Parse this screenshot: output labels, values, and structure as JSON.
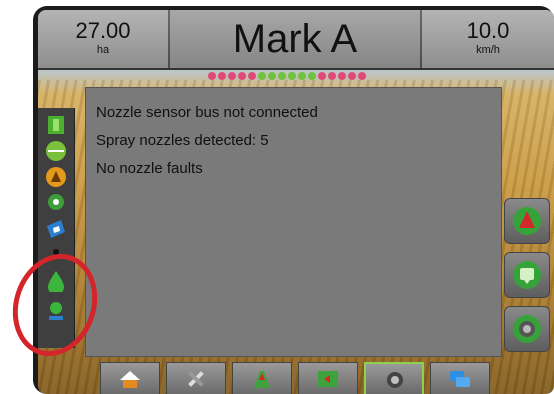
{
  "header": {
    "area_value": "27.00",
    "area_unit": "ha",
    "title": "Mark A",
    "speed_value": "10.0",
    "speed_unit": "km/h"
  },
  "status_leds": [
    "pink",
    "pink",
    "pink",
    "pink",
    "pink",
    "green",
    "green",
    "green",
    "green",
    "green",
    "green",
    "pink",
    "pink",
    "pink",
    "pink",
    "pink"
  ],
  "dialog": {
    "messages": [
      "Nozzle sensor bus not connected",
      "Spray nozzles detected: 5",
      "No nozzle faults"
    ]
  },
  "left_panel": {
    "icons": [
      "boom-section-icon",
      "green-lines-icon",
      "steering-status-icon",
      "gps-status-icon",
      "tilt-sensor-icon",
      "separator-icon",
      "nozzle-drop-icon",
      "nozzle-sensor-icon"
    ]
  },
  "right_buttons": [
    "navigation-arrow-icon",
    "guidance-screen-icon",
    "camera-icon"
  ],
  "toolbar": {
    "buttons": [
      "home-icon",
      "tools-icon",
      "vehicle-view-icon",
      "field-view-icon",
      "camera-view-icon",
      "multiscreen-icon"
    ],
    "active_index": 4
  },
  "colors": {
    "accent_green": "#8fd14f",
    "annotation_red": "#d4252a"
  }
}
